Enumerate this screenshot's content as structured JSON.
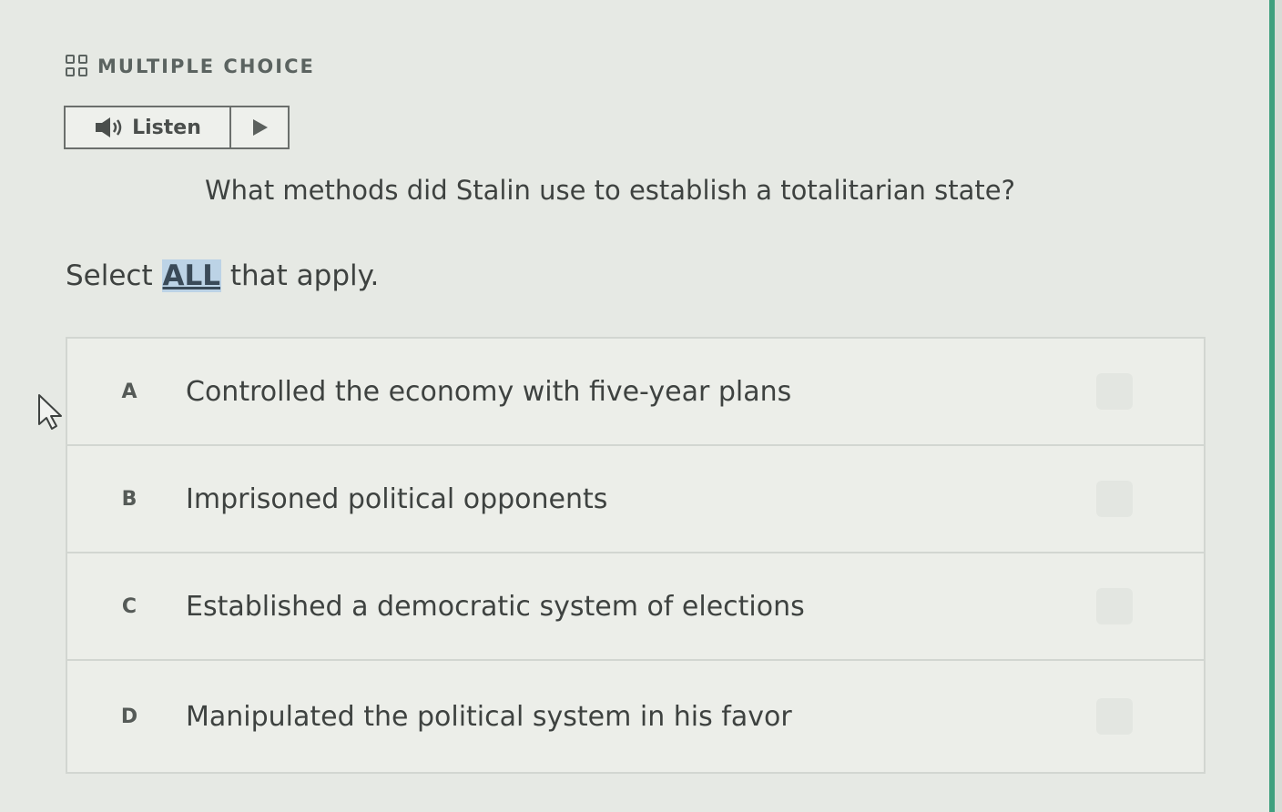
{
  "header": {
    "section_label": "MULTIPLE CHOICE",
    "section_icon": "grid-icon"
  },
  "listen": {
    "label": "Listen",
    "speaker_icon": "speaker-icon",
    "play_icon": "play-icon"
  },
  "question": {
    "text": "What methods did Stalin use to establish a totalitarian state?"
  },
  "instruction": {
    "before": "Select ",
    "highlight": "ALL",
    "after": " that apply."
  },
  "options": [
    {
      "letter": "A",
      "text": "Controlled the economy with five-year plans"
    },
    {
      "letter": "B",
      "text": "Imprisoned political opponents"
    },
    {
      "letter": "C",
      "text": "Established a democratic system of elections"
    },
    {
      "letter": "D",
      "text": "Manipulated the political system in his favor"
    }
  ],
  "colors": {
    "accent_rule": "#3fa07e",
    "highlight_bg": "#bcd3e6",
    "page_bg": "#e6e9e4"
  }
}
